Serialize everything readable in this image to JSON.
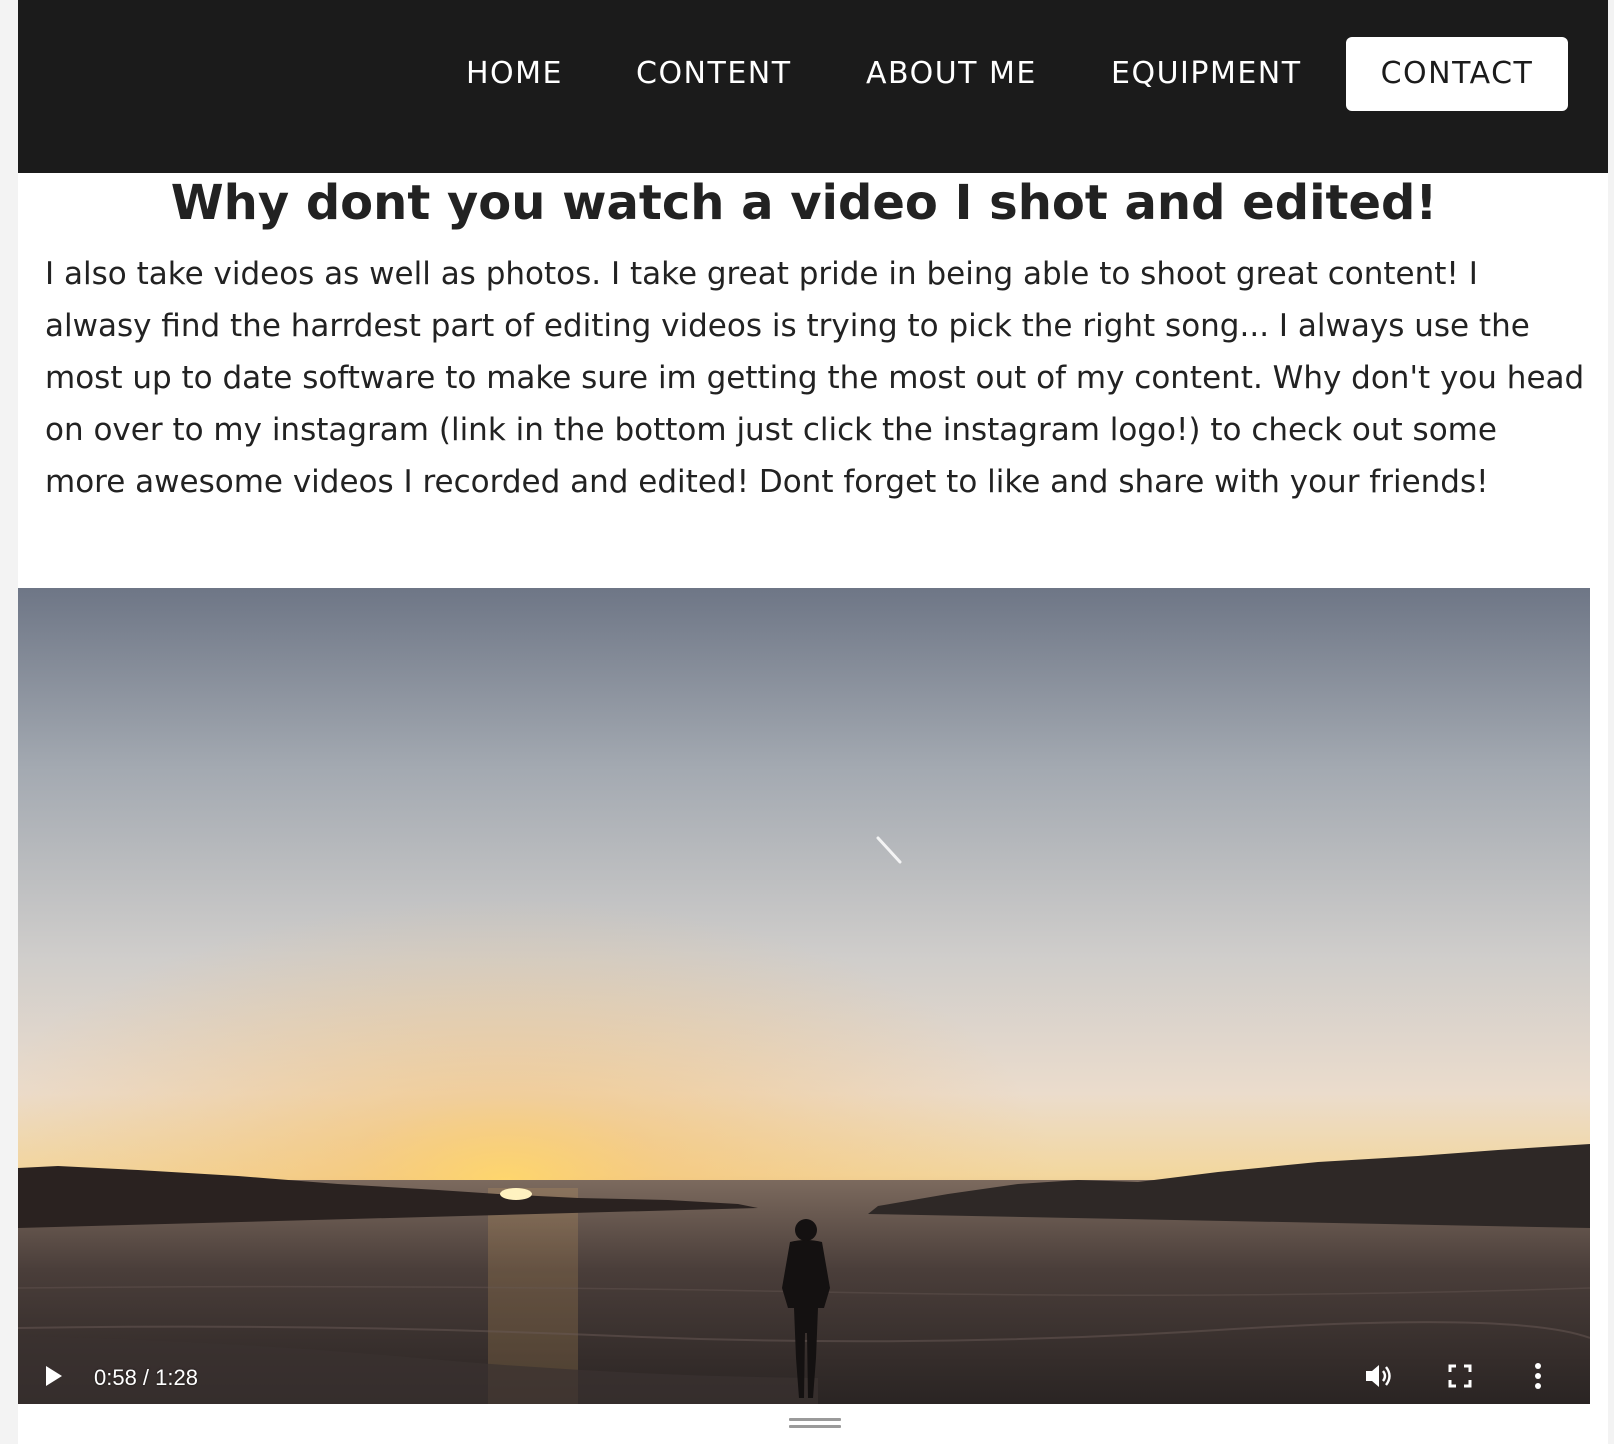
{
  "nav": {
    "items": [
      {
        "label": "HOME"
      },
      {
        "label": "CONTENT"
      },
      {
        "label": "ABOUT ME"
      },
      {
        "label": "EQUIPMENT"
      }
    ],
    "contact_label": "CONTACT"
  },
  "main": {
    "title": "Why dont you watch a video I shot and edited!",
    "paragraph": "I also take videos as well as photos. I take great pride in being able to shoot great content! I alwasy find the harrdest part of editing videos is trying to pick the right song... I always use the most up to date software to make sure im getting the most out of my content. Why don't you head on over to my instagram (link in the bottom just click the instagram logo!) to check out some more awesome videos I recorded and edited! Dont forget to like and share with your friends!"
  },
  "video": {
    "time_display": "0:58 / 1:28",
    "current_time": "0:58",
    "duration": "1:28",
    "icons": {
      "play": "play-icon",
      "volume": "volume-icon",
      "fullscreen": "fullscreen-icon",
      "more": "more-options-icon"
    }
  },
  "colors": {
    "navbar_bg": "#1b1b1b",
    "nav_text": "#ffffff",
    "contact_bg": "#ffffff",
    "text": "#222222"
  }
}
